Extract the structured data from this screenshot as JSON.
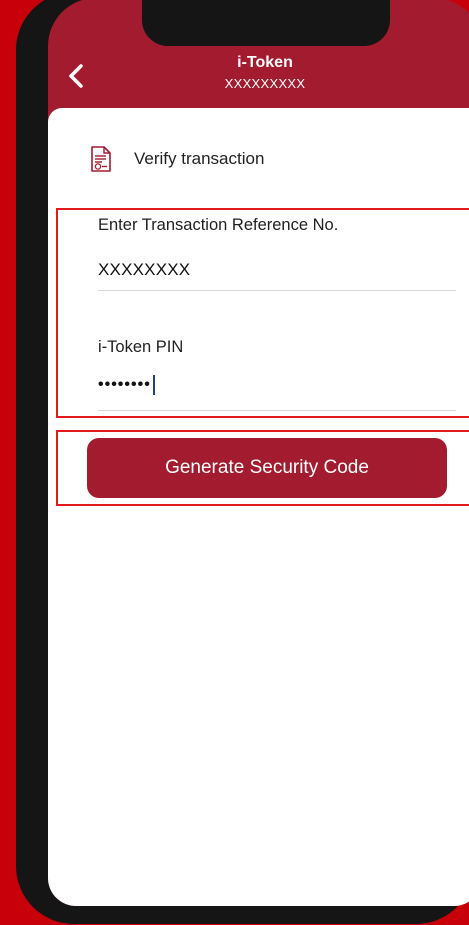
{
  "header": {
    "title": "i-Token",
    "subtitle": "XXXXXXXXX"
  },
  "section": {
    "icon": "document-icon",
    "title": "Verify transaction"
  },
  "fields": {
    "reference": {
      "label": "Enter Transaction Reference No.",
      "value": "XXXXXXXX"
    },
    "pin": {
      "label": "i-Token PIN",
      "value": "••••••••"
    }
  },
  "actions": {
    "generate_label": "Generate Security Code"
  },
  "colors": {
    "brand": "#a31b2e",
    "highlight": "#e11b1b",
    "background": "#c8000a",
    "caret": "#1c3f8f"
  }
}
